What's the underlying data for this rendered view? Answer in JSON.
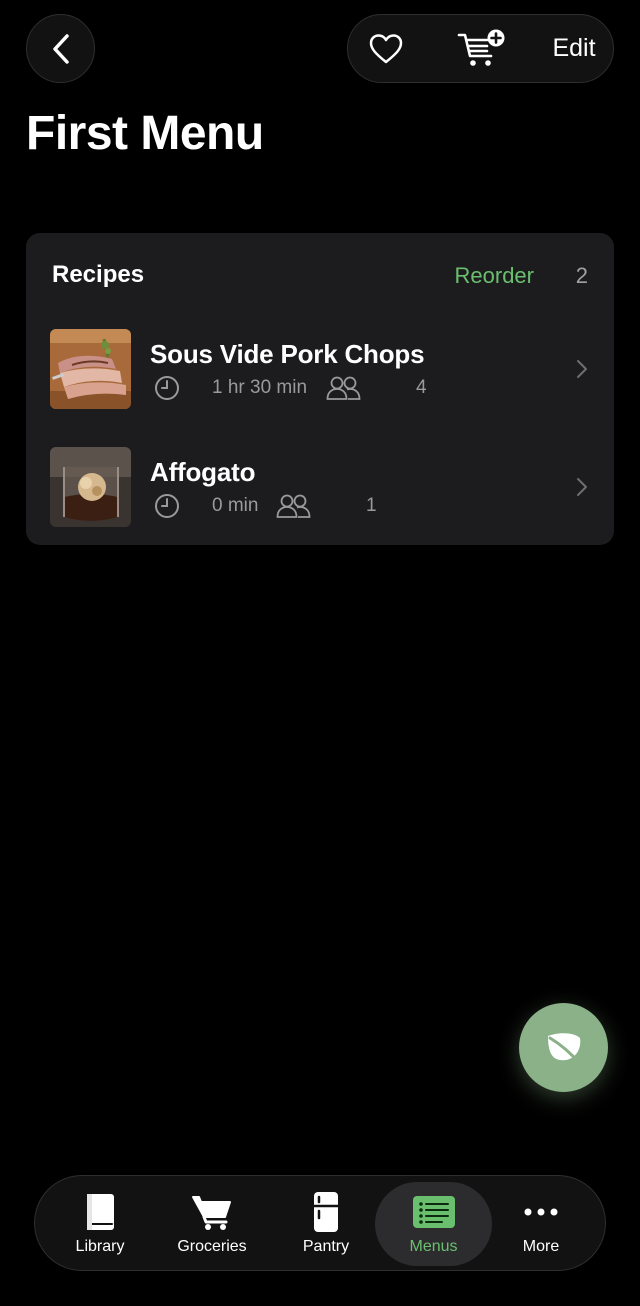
{
  "header": {
    "back_icon": "chevron-left-icon",
    "favorite_icon": "heart-icon",
    "cart_icon": "cart-plus-icon",
    "edit_label": "Edit"
  },
  "page": {
    "title": "First Menu"
  },
  "recipes_section": {
    "title": "Recipes",
    "reorder_label": "Reorder",
    "count": "2",
    "items": [
      {
        "name": "Sous Vide Pork Chops",
        "time": "1 hr 30 min",
        "servings": "4",
        "time_icon": "clock-icon",
        "servings_icon": "people-icon"
      },
      {
        "name": "Affogato",
        "time": "0 min",
        "servings": "1",
        "time_icon": "clock-icon",
        "servings_icon": "people-icon"
      }
    ]
  },
  "fab": {
    "icon": "leaf-icon"
  },
  "tabbar": {
    "active": "Menus",
    "tabs": [
      {
        "label": "Library",
        "icon": "book-icon"
      },
      {
        "label": "Groceries",
        "icon": "cart-icon"
      },
      {
        "label": "Pantry",
        "icon": "fridge-icon"
      },
      {
        "label": "Menus",
        "icon": "list-icon"
      },
      {
        "label": "More",
        "icon": "more-dots-icon"
      }
    ]
  },
  "colors": {
    "accent": "#6abf6e",
    "fab": "#8ab187",
    "card": "#1c1c1e",
    "background": "#000000"
  }
}
